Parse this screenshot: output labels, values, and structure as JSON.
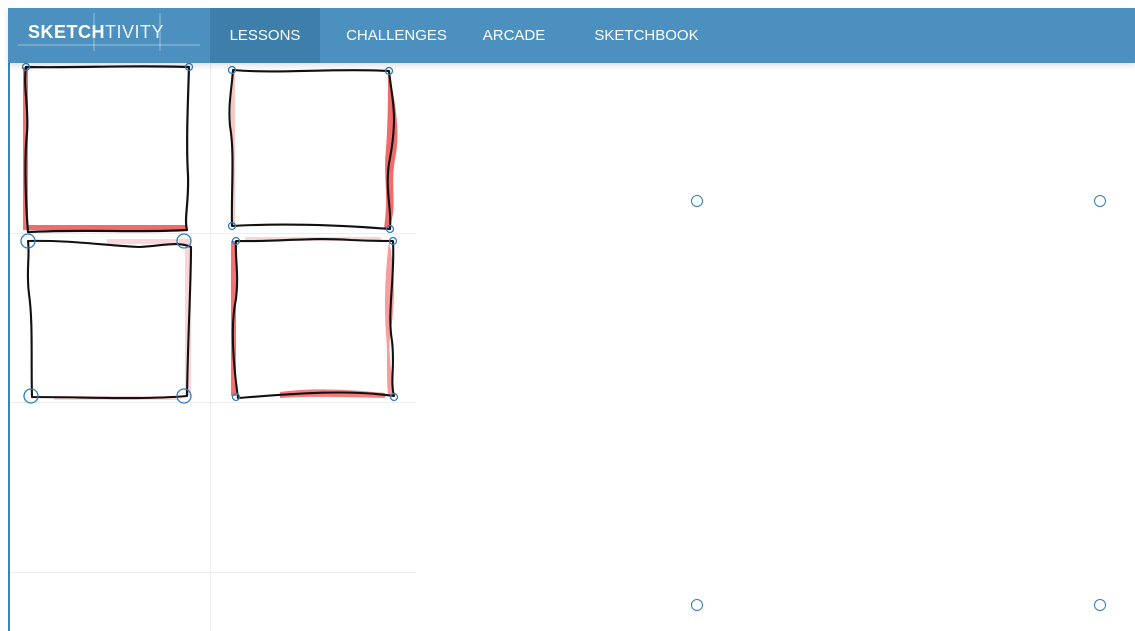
{
  "app": {
    "brand_bold": "SKETCH",
    "brand_light": "TIVITY",
    "colors": {
      "navbar": "#4b90be",
      "navbar_active": "#3d7faa",
      "point_stroke": "#2f7db6",
      "sketch_stroke": "#111111",
      "guide_fill": "#f15b5b",
      "canvas_background": "#ffffff"
    }
  },
  "nav": {
    "items": [
      {
        "label": "LESSONS",
        "active": true
      },
      {
        "label": "CHALLENGES",
        "active": false
      },
      {
        "label": "ARCADE",
        "active": false
      },
      {
        "label": "SKETCHBOOK",
        "active": false
      }
    ]
  },
  "canvas": {
    "exercise_points": 4,
    "completed_sketches": 4,
    "empty_slots": 4,
    "background": "white",
    "point_icon": "ring-point-icon"
  }
}
